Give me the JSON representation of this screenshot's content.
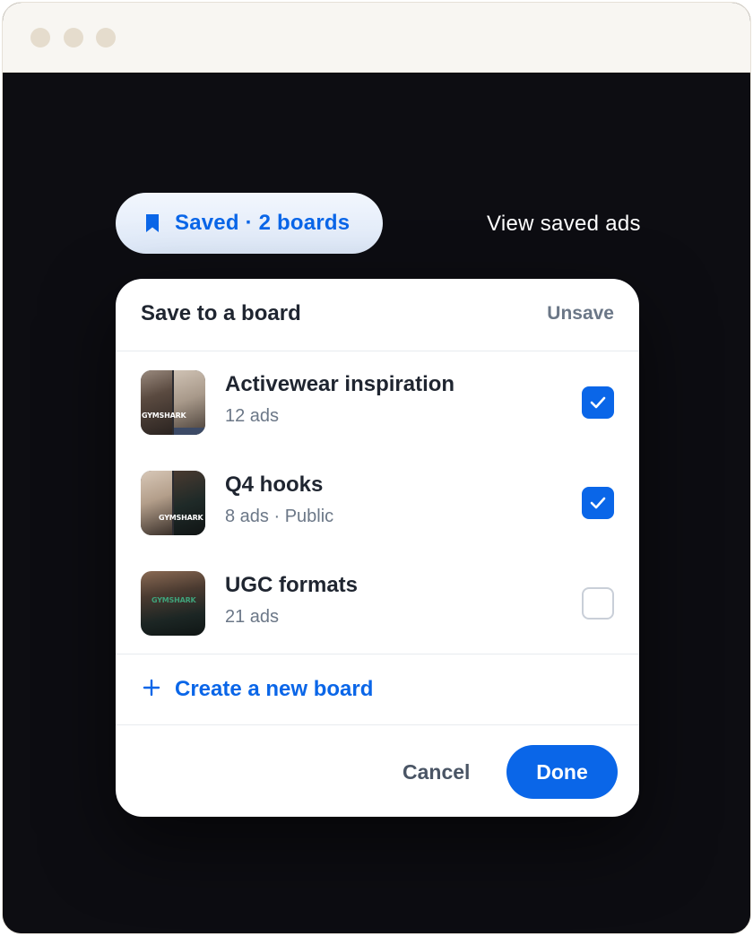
{
  "window": {
    "traffic_lights": [
      "dot",
      "dot",
      "dot"
    ]
  },
  "save_status": {
    "label": "Saved · 2 boards",
    "icon": "bookmark-icon",
    "view_link": "View saved ads"
  },
  "panel": {
    "title": "Save to a board",
    "unsave_label": "Unsave",
    "boards": [
      {
        "name": "Activewear inspiration",
        "meta": "12 ads",
        "checked": true,
        "thumb_text": "GYMSHARK"
      },
      {
        "name": "Q4 hooks",
        "meta": "8 ads · Public",
        "checked": true,
        "thumb_text": "GYMSHARK"
      },
      {
        "name": "UGC formats",
        "meta": "21 ads",
        "checked": false,
        "thumb_text": "GYMSHARK"
      }
    ],
    "create_label": "Create a new board",
    "cancel_label": "Cancel",
    "done_label": "Done"
  },
  "colors": {
    "accent": "#0a66e8",
    "background": "#0d0d12",
    "muted_text": "#6b7787"
  }
}
